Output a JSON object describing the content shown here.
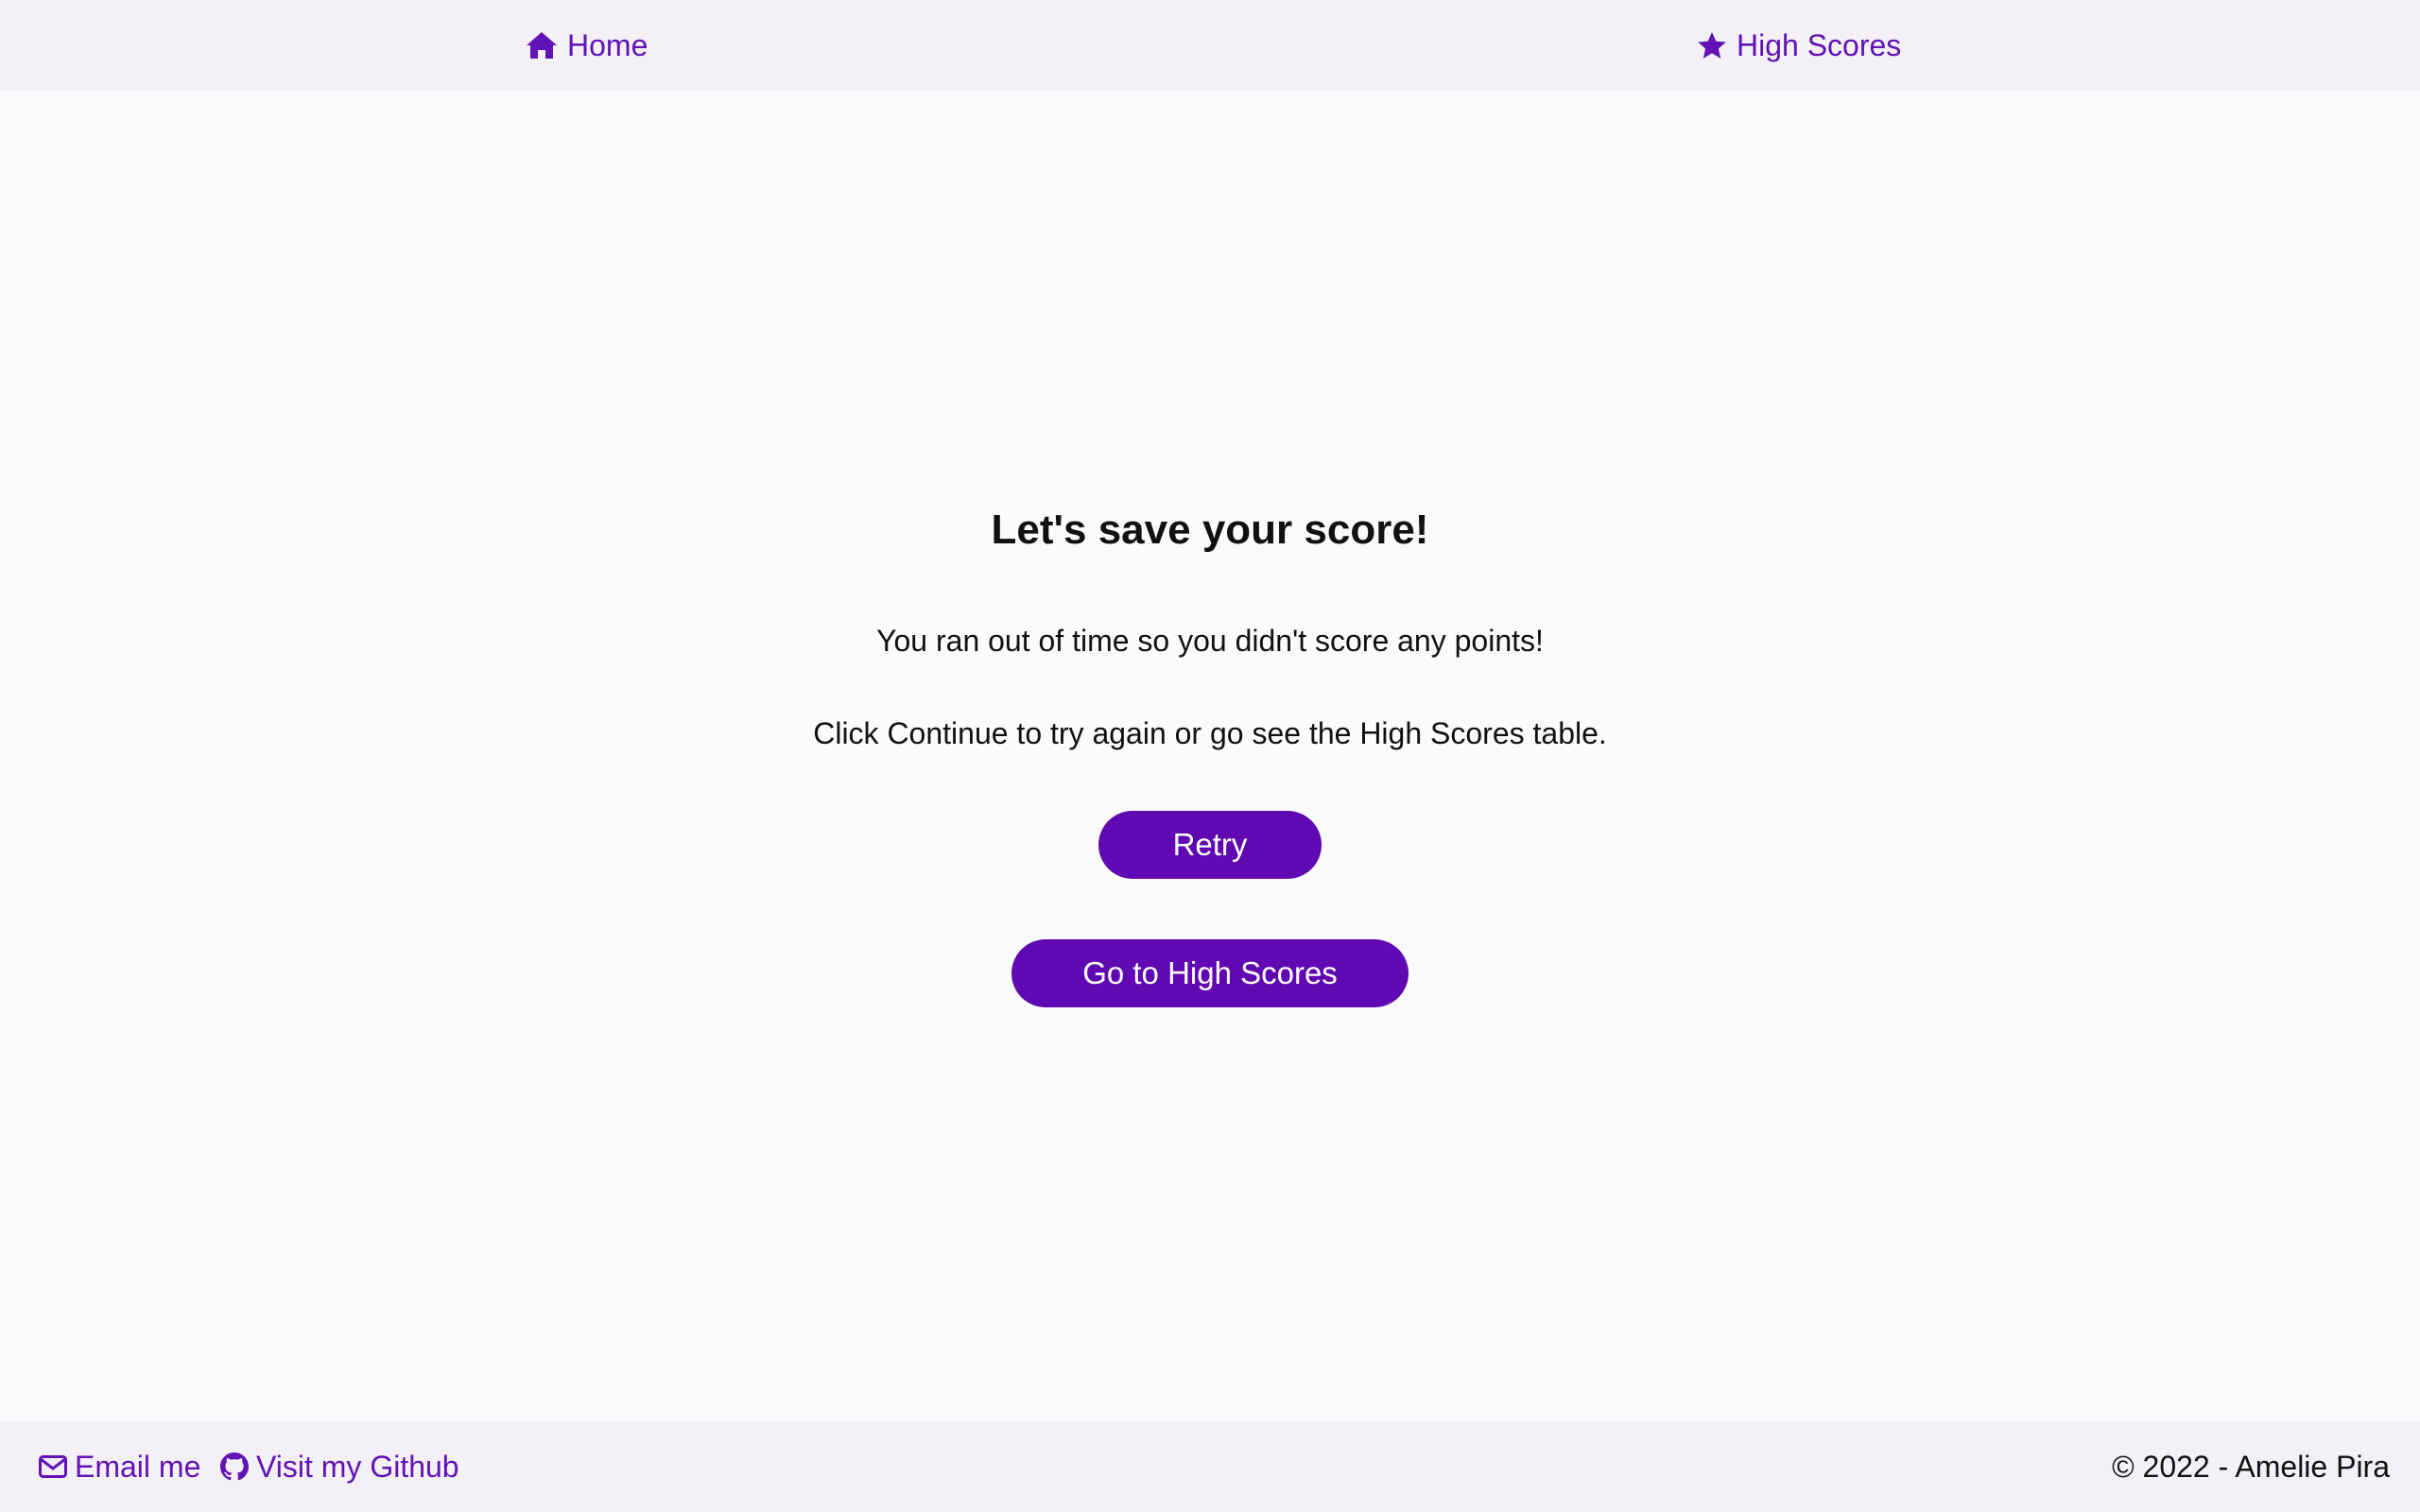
{
  "colors": {
    "accent": "#6009b2",
    "link": "#6113b5",
    "bar_background": "#f3f0f6",
    "page_background": "#fafbfc"
  },
  "nav": {
    "home": {
      "label": "Home",
      "icon": "home-icon"
    },
    "high_scores": {
      "label": "High Scores",
      "icon": "star-icon"
    }
  },
  "main": {
    "title": "Let's save your score!",
    "message": "You ran out of time so you didn't score any points!",
    "instruction": "Click Continue to try again or go see the High Scores table.",
    "retry_label": "Retry",
    "high_scores_label": "Go to High Scores"
  },
  "footer": {
    "email": {
      "label": "Email me",
      "icon": "envelope-icon"
    },
    "github": {
      "label": "Visit my Github",
      "icon": "github-icon"
    },
    "copyright": "© 2022 - Amelie Pira"
  }
}
